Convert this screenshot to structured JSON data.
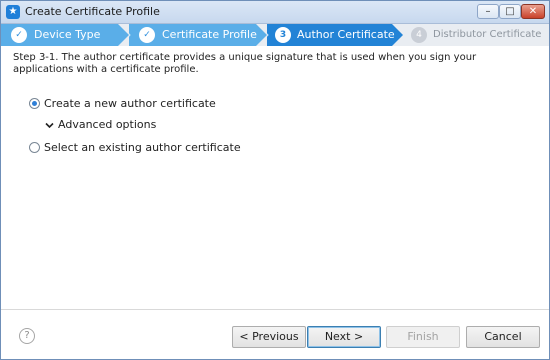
{
  "window": {
    "title": "Create Certificate Profile",
    "app_icon": "star-icon",
    "controls": {
      "minimize": "–",
      "maximize": "□",
      "close": "✕"
    }
  },
  "steps": [
    {
      "label": "Device Type",
      "state": "completed",
      "indicator": "✓"
    },
    {
      "label": "Certificate Profile",
      "state": "completed",
      "indicator": "✓"
    },
    {
      "label": "Author Certificate",
      "state": "current",
      "indicator": "3"
    },
    {
      "label": "Distributor Certificate",
      "state": "pending",
      "indicator": "4"
    }
  ],
  "description": "Step 3-1. The author certificate provides a unique signature that is used when you sign your applications with a certificate profile.",
  "options": {
    "create_new": {
      "label": "Create a new author certificate",
      "selected": true
    },
    "advanced": {
      "label": "Advanced options",
      "expanded": true
    },
    "select_existing": {
      "label": "Select an existing author certificate",
      "selected": false
    }
  },
  "footer": {
    "help": "?",
    "previous": "< Previous",
    "next": "Next >",
    "finish": "Finish",
    "cancel": "Cancel"
  },
  "colors": {
    "step_completed": "#5aaee8",
    "step_current": "#2283d6",
    "step_pending": "#e9edf2"
  }
}
